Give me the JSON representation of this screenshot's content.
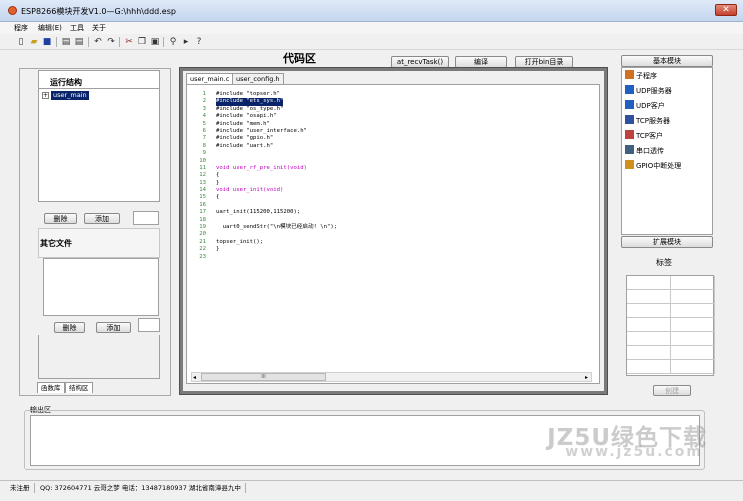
{
  "window": {
    "title": "ESP8266模块开发V1.0—G:\\hhh\\ddd.esp",
    "close": "✕"
  },
  "menu": [
    "程序",
    "编辑(E)",
    "工具",
    "关于"
  ],
  "toolbar_icons": [
    "new-file-icon",
    "open-folder-icon",
    "save-icon",
    "page-icon",
    "page2-icon",
    "undo-icon",
    "redo-icon",
    "cut-icon",
    "copy-icon",
    "paste-icon",
    "find-icon",
    "run-icon",
    "help-icon"
  ],
  "left_panel": {
    "struct_title": "运行结构",
    "tree_item": "user_main",
    "tree_expander": "+",
    "delete_label": "删除",
    "add_label": "添加",
    "other_title": "其它文件",
    "delete2_label": "删除",
    "add2_label": "添加",
    "tabs": [
      "函数库",
      "结构区"
    ]
  },
  "code_area": {
    "title": "代码区",
    "buttons": [
      "at_recvTask()",
      "编译",
      "打开bin目录"
    ],
    "tabs": [
      "user_main.c",
      "user_config.h"
    ],
    "scroll_thumb": "III"
  },
  "code_lines": [
    {
      "n": "1",
      "t": "#include \"topser.h\"",
      "hl": false
    },
    {
      "n": "2",
      "t": "#include \"ets_sys.h\"",
      "hl": true
    },
    {
      "n": "3",
      "t": "#include \"os_type.h\"",
      "hl": false
    },
    {
      "n": "4",
      "t": "#include \"osapi.h\"",
      "hl": false
    },
    {
      "n": "5",
      "t": "#include \"mem.h\"",
      "hl": false
    },
    {
      "n": "6",
      "t": "#include \"user_interface.h\"",
      "hl": false
    },
    {
      "n": "7",
      "t": "#include \"gpio.h\"",
      "hl": false
    },
    {
      "n": "8",
      "t": "#include \"uart.h\"",
      "hl": false
    },
    {
      "n": "9",
      "t": "",
      "hl": false
    },
    {
      "n": "10",
      "t": "",
      "hl": false
    },
    {
      "n": "11",
      "t": "void user_rf_pre_init(void)",
      "hl": false
    },
    {
      "n": "12",
      "t": "{",
      "hl": false
    },
    {
      "n": "13",
      "t": "}",
      "hl": false
    },
    {
      "n": "14",
      "t": "void user_init(void)",
      "hl": false
    },
    {
      "n": "15",
      "t": "{",
      "hl": false
    },
    {
      "n": "16",
      "t": "",
      "hl": false
    },
    {
      "n": "17",
      "t": "uart_init(115200,115200);",
      "hl": false
    },
    {
      "n": "18",
      "t": "",
      "hl": false
    },
    {
      "n": "19",
      "t": "  uart0_sendStr(\"\\n模块已经启动! \\n\");",
      "hl": false
    },
    {
      "n": "20",
      "t": "",
      "hl": false
    },
    {
      "n": "21",
      "t": "topser_init();",
      "hl": false
    },
    {
      "n": "22",
      "t": "}",
      "hl": false
    },
    {
      "n": "23",
      "t": "",
      "hl": false
    }
  ],
  "right_panel": {
    "basic_title": "基本模块",
    "modules": [
      {
        "label": "子程序",
        "icon": "subroutine-icon"
      },
      {
        "label": "UDP服务器",
        "icon": "udp-server-icon"
      },
      {
        "label": "UDP客户",
        "icon": "udp-client-icon"
      },
      {
        "label": "TCP服务器",
        "icon": "tcp-server-icon"
      },
      {
        "label": "TCP客户",
        "icon": "tcp-client-icon"
      },
      {
        "label": "串口透传",
        "icon": "serial-passthrough-icon"
      },
      {
        "label": "GPIO中断处理",
        "icon": "gpio-interrupt-icon"
      }
    ],
    "ext_title": "扩展模块",
    "tag_label": "标签",
    "create_label": "创建"
  },
  "output": {
    "label": "输出区"
  },
  "status": {
    "left": "未注册",
    "info": "QQ: 372604771  云哥之梦  电话：13487180937  湖北省南漳县九中"
  },
  "watermark": {
    "line1": "JZ5U绿色下载",
    "line2": "www.jz5u.com"
  },
  "colors": {
    "accent": "#0a246a",
    "code_number": "#3a8a3a",
    "keyword": "#c000c0"
  }
}
